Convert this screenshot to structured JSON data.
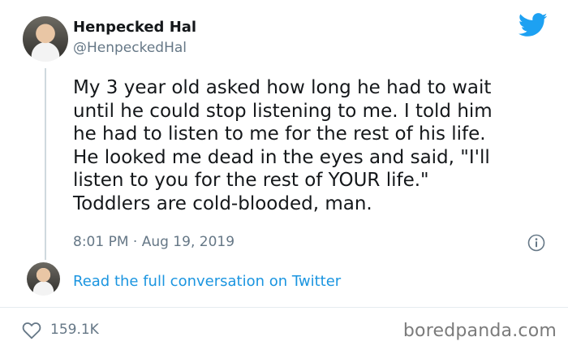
{
  "tweet": {
    "author_name": "Henpecked Hal",
    "author_handle": "@HenpeckedHal",
    "text": "My 3 year old asked how long he had to wait\nuntil he could stop listening to me. I told him\nhe had to listen to me for the rest of his life.\nHe looked me dead in the eyes and said, \"I'll\nlisten to you for the rest of YOUR life.\"\nToddlers are cold-blooded, man.",
    "timestamp": "8:01 PM · Aug 19, 2019",
    "read_more_link": "Read the full conversation on Twitter",
    "likes": "159.1K"
  },
  "branding": {
    "platform_icon": "twitter-bird-icon",
    "watermark": "boredpanda.com"
  },
  "colors": {
    "twitter_blue": "#1da1f2",
    "link_blue": "#1b95e0",
    "muted_gray": "#657786",
    "text": "#14171a"
  }
}
